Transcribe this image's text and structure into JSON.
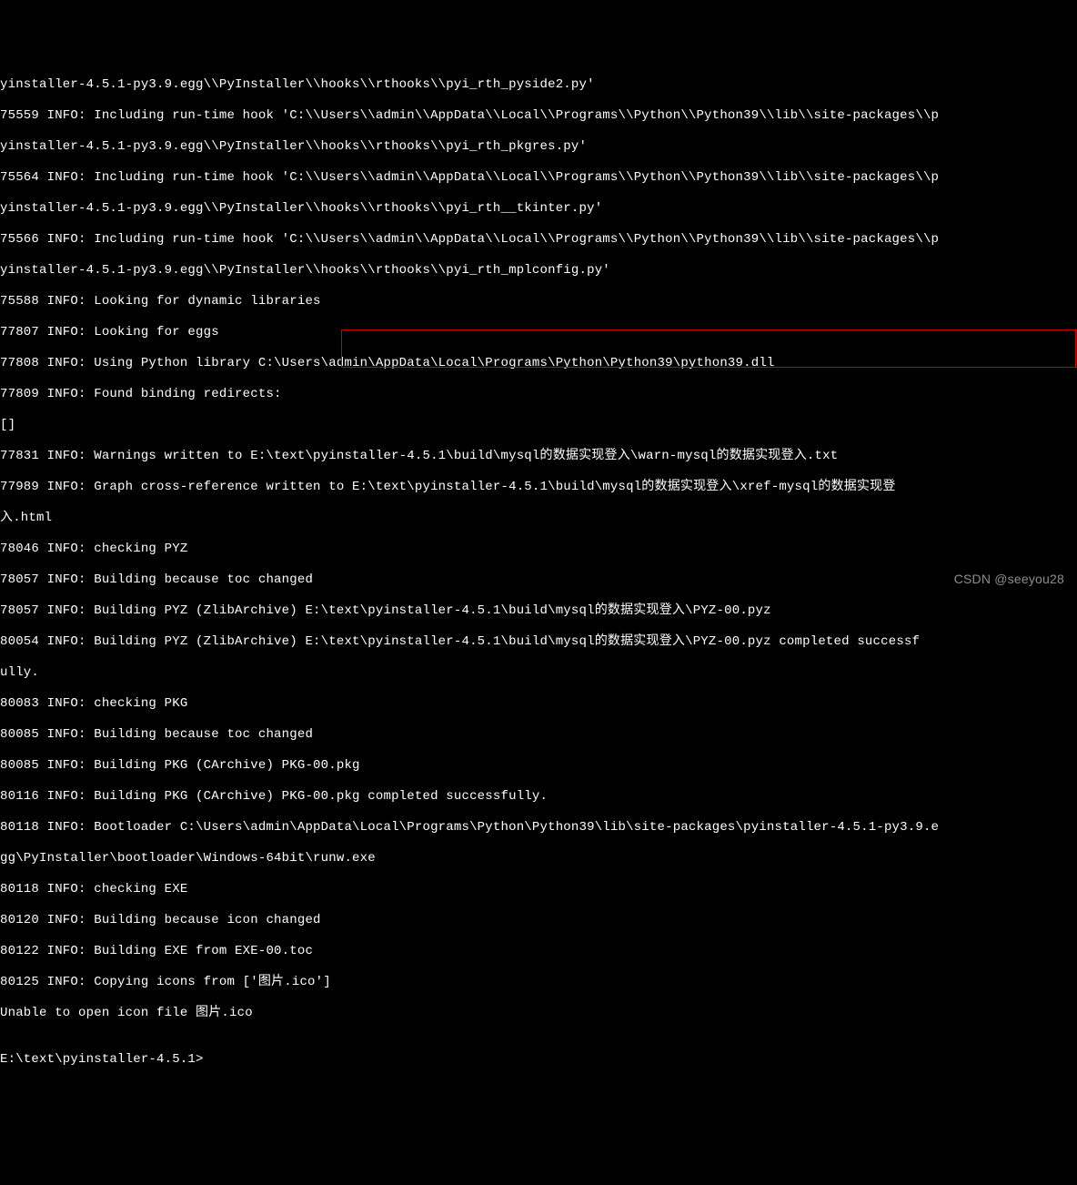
{
  "lines": [
    "yinstaller-4.5.1-py3.9.egg\\\\PyInstaller\\\\hooks\\\\rthooks\\\\pyi_rth_pyside2.py'",
    "75559 INFO: Including run-time hook 'C:\\\\Users\\\\admin\\\\AppData\\\\Local\\\\Programs\\\\Python\\\\Python39\\\\lib\\\\site-packages\\\\p",
    "yinstaller-4.5.1-py3.9.egg\\\\PyInstaller\\\\hooks\\\\rthooks\\\\pyi_rth_pkgres.py'",
    "75564 INFO: Including run-time hook 'C:\\\\Users\\\\admin\\\\AppData\\\\Local\\\\Programs\\\\Python\\\\Python39\\\\lib\\\\site-packages\\\\p",
    "yinstaller-4.5.1-py3.9.egg\\\\PyInstaller\\\\hooks\\\\rthooks\\\\pyi_rth__tkinter.py'",
    "75566 INFO: Including run-time hook 'C:\\\\Users\\\\admin\\\\AppData\\\\Local\\\\Programs\\\\Python\\\\Python39\\\\lib\\\\site-packages\\\\p",
    "yinstaller-4.5.1-py3.9.egg\\\\PyInstaller\\\\hooks\\\\rthooks\\\\pyi_rth_mplconfig.py'",
    "75588 INFO: Looking for dynamic libraries",
    "77807 INFO: Looking for eggs",
    "77808 INFO: Using Python library C:\\Users\\admin\\AppData\\Local\\Programs\\Python\\Python39\\python39.dll",
    "77809 INFO: Found binding redirects:",
    "[]",
    "77831 INFO: Warnings written to E:\\text\\pyinstaller-4.5.1\\build\\mysql的数据实现登入\\warn-mysql的数据实现登入.txt",
    "77989 INFO: Graph cross-reference written to E:\\text\\pyinstaller-4.5.1\\build\\mysql的数据实现登入\\xref-mysql的数据实现登",
    "入.html",
    "78046 INFO: checking PYZ",
    "78057 INFO: Building because toc changed",
    "78057 INFO: Building PYZ (ZlibArchive) E:\\text\\pyinstaller-4.5.1\\build\\mysql的数据实现登入\\PYZ-00.pyz",
    "80054 INFO: Building PYZ (ZlibArchive) E:\\text\\pyinstaller-4.5.1\\build\\mysql的数据实现登入\\PYZ-00.pyz completed successf",
    "ully.",
    "80083 INFO: checking PKG",
    "80085 INFO: Building because toc changed",
    "80085 INFO: Building PKG (CArchive) PKG-00.pkg",
    "80116 INFO: Building PKG (CArchive) PKG-00.pkg completed successfully.",
    "80118 INFO: Bootloader C:\\Users\\admin\\AppData\\Local\\Programs\\Python\\Python39\\lib\\site-packages\\pyinstaller-4.5.1-py3.9.e",
    "gg\\PyInstaller\\bootloader\\Windows-64bit\\runw.exe",
    "80118 INFO: checking EXE",
    "80120 INFO: Building because icon changed",
    "80122 INFO: Building EXE from EXE-00.toc",
    "80125 INFO: Copying icons from ['图片.ico']",
    "Unable to open icon file 图片.ico",
    "",
    "E:\\text\\pyinstaller-4.5.1>"
  ],
  "watermark": "CSDN @seeyou28"
}
